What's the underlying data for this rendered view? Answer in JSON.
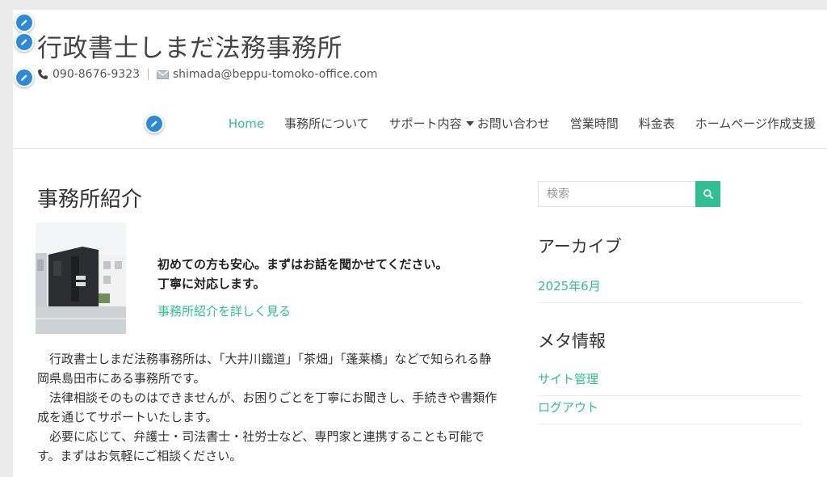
{
  "site": {
    "title": "行政書士しまだ法務事務所",
    "phone": "090-8676-9323",
    "email": "shimada@beppu-tomoko-office.com"
  },
  "nav": {
    "items": [
      {
        "label": "Home"
      },
      {
        "label": "事務所について"
      },
      {
        "label": "サポート内容"
      },
      {
        "label": "お問い合わせ"
      },
      {
        "label": "営業時間"
      },
      {
        "label": "料金表"
      },
      {
        "label": "ホームページ作成支援"
      }
    ]
  },
  "main": {
    "title": "事務所紹介",
    "intro_line1": "初めての方も安心。まずはお話を聞かせてください。",
    "intro_line2": "丁寧に対応します。",
    "more_link": "事務所紹介を詳しく見る",
    "paragraphs": [
      "行政書士しまだ法務事務所は、「大井川鐵道」「茶畑」「蓬莱橋」などで知られる静岡県島田市にある事務所です。",
      "法律相談そのものはできませんが、お困りごとを丁寧にお聞きし、手続きや書類作成を通じてサポートいたします。",
      "必要に応じて、弁護士・司法書士・社労士など、専門家と連携することも可能です。まずはお気軽にご相談ください。"
    ]
  },
  "sidebar": {
    "search_placeholder": "検索",
    "archive_title": "アーカイブ",
    "archive_items": [
      "2025年6月"
    ],
    "meta_title": "メタ情報",
    "meta_items": [
      "サイト管理",
      "ログアウト"
    ]
  },
  "colors": {
    "accent": "#30bf91",
    "edit_pencil": "#2c8ad8"
  }
}
